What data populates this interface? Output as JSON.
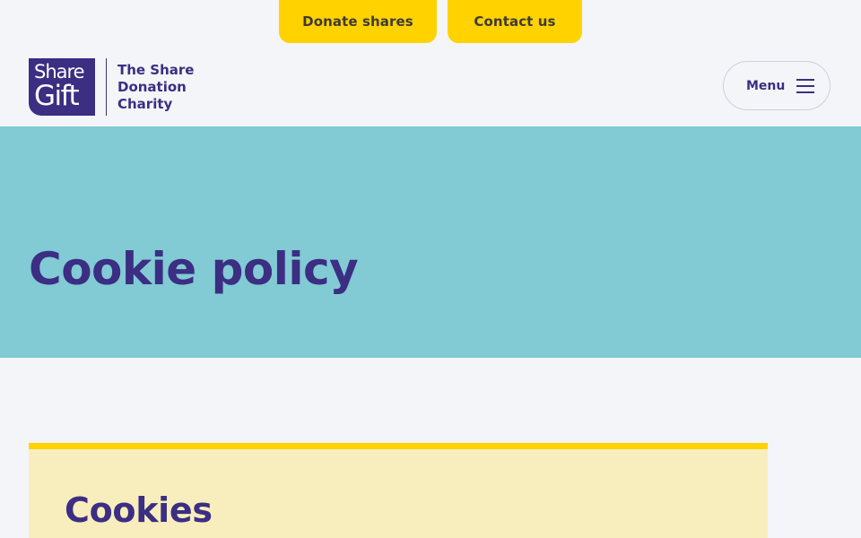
{
  "top_bar": {
    "donate_label": "Donate shares",
    "contact_label": "Contact us"
  },
  "logo": {
    "mark_line1": "Share",
    "mark_line2": "Gift",
    "tagline_line1": "The Share",
    "tagline_line2": "Donation",
    "tagline_line3": "Charity"
  },
  "header": {
    "menu_label": "Menu",
    "menu_icon": "hamburger-icon"
  },
  "hero": {
    "title": "Cookie policy"
  },
  "content": {
    "section_title": "Cookies"
  },
  "colors": {
    "brand_purple": "#3b2e83",
    "accent_yellow": "#ffd200",
    "hero_teal": "#82cad4",
    "card_cream": "#f8eebd",
    "page_background": "#f4f5f9"
  }
}
